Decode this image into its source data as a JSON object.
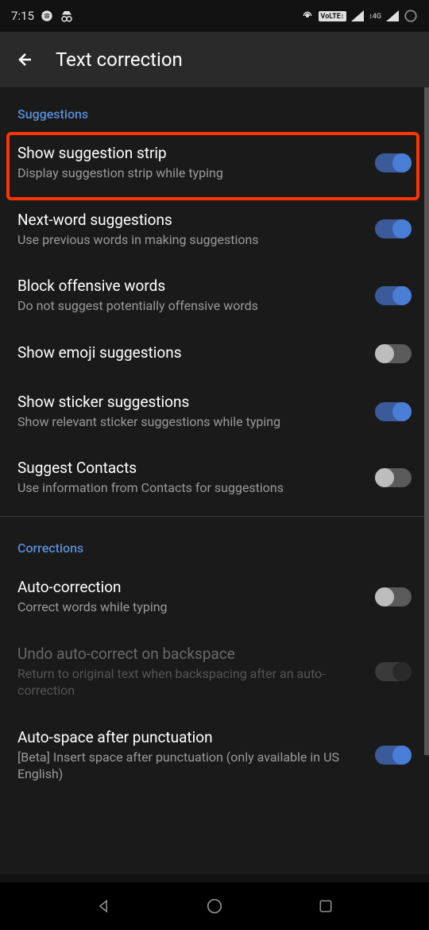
{
  "status": {
    "time": "7:15"
  },
  "header": {
    "title": "Text correction"
  },
  "sections": {
    "suggestions": {
      "header": "Suggestions",
      "items": [
        {
          "title": "Show suggestion strip",
          "subtitle": "Display suggestion strip while typing",
          "on": true
        },
        {
          "title": "Next-word suggestions",
          "subtitle": "Use previous words in making suggestions",
          "on": true
        },
        {
          "title": "Block offensive words",
          "subtitle": "Do not suggest potentially offensive words",
          "on": true
        },
        {
          "title": "Show emoji suggestions",
          "subtitle": "",
          "on": false
        },
        {
          "title": "Show sticker suggestions",
          "subtitle": "Show relevant sticker suggestions while typing",
          "on": true
        },
        {
          "title": "Suggest Contacts",
          "subtitle": "Use information from Contacts for suggestions",
          "on": false
        }
      ]
    },
    "corrections": {
      "header": "Corrections",
      "items": [
        {
          "title": "Auto-correction",
          "subtitle": "Correct words while typing",
          "on": false
        },
        {
          "title": "Undo auto-correct on backspace",
          "subtitle": "Return to original text when backspacing after an auto-correction",
          "disabled": true
        },
        {
          "title": "Auto-space after punctuation",
          "subtitle": "[Beta] Insert space after punctuation (only available in US English)",
          "on": true
        }
      ]
    }
  }
}
